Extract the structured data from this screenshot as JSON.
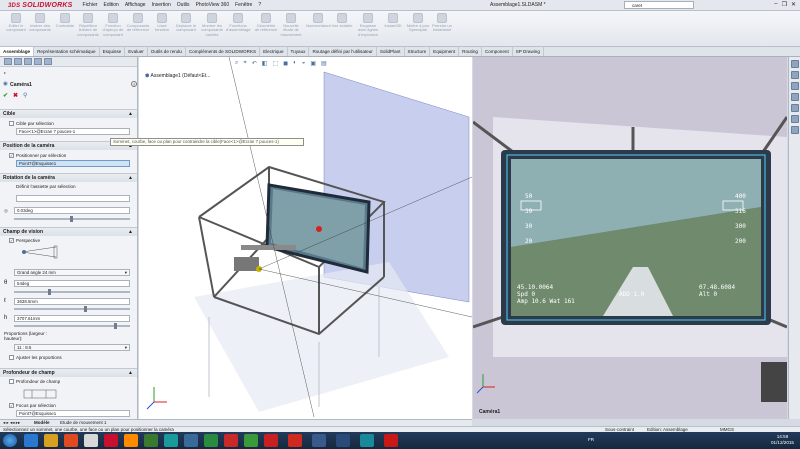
{
  "app": {
    "logo_prefix": "3DS",
    "logo_text": "SOLIDWORKS",
    "document_title": "Assemblage1.SLDASM *",
    "search_value": "caret",
    "menu": [
      "Fichier",
      "Edition",
      "Affichage",
      "Insertion",
      "Outils",
      "PhotoView 360",
      "Fenêtre",
      "?"
    ]
  },
  "ribbon": {
    "buttons": [
      "Editer le composant",
      "Insérer des composants",
      "Contrainte",
      "Répétition linéaire de composants",
      "Fonction d'aperçu de composant",
      "Composants de référence",
      "Lissé fonction",
      "Déplacer le composant",
      "Montrer les composants cachés",
      "Fonctions d'assemblage",
      "Géométrie de référence",
      "Nouvelle étude de mouvement",
      "Nomenclature",
      "Vue éclatée",
      "Esquisse avec lignes d'explosion",
      "Instant3D",
      "Mettre à jour Speedpak",
      "Prendre un instantané"
    ]
  },
  "tabs": [
    "Assemblage",
    "Représentation schématique",
    "Esquisse",
    "Evaluer",
    "Outils de rendu",
    "Compléments de SOLIDWORKS",
    "Electrique",
    "Tuyaux",
    "Routage défini par l'utilisateur",
    "SolidPlant",
    "Structure",
    "Equipment",
    "Routing",
    "Component",
    "SP Drawing"
  ],
  "panel": {
    "title": "Caméra1",
    "help_icon": "?",
    "sections": {
      "target": "Cible",
      "camera_position": "Position de la caméra",
      "camera_rotation": "Rotation de la caméra",
      "field_of_view": "Champ de vision",
      "depth_of_field": "Profondeur de champ"
    },
    "target_checkbox": "Cible par sélection",
    "target_value": "Face<1>@Ecran 7 pouces-1",
    "position_checkbox": "Positionner par sélection",
    "position_value": "Point7@Esquisse1",
    "rotation_label": "Définir l'assiette par sélection",
    "rotation_value": "0.03deg",
    "perspective_label": "Perspective",
    "lens": "Grand angle 24 mm",
    "angle_value": "54deg",
    "distance_value": "3638.5mm",
    "height_value": "3707.61mm",
    "proportions_label": "Proportions (largeur : hauteur):",
    "proportions_value": "11 : 8.5",
    "adjust_label": "Ajuster les proportions",
    "depth_label": "Profondeur de champ",
    "focus_label": "Focus par sélection",
    "focus_value": "Point7@Esquisse1"
  },
  "tooltip": "Sommet, courbe, face ou plan pour contraindre la cible(Face<1>@Ecran 7 pouces-1)",
  "viewport": {
    "tree_label": "Assemblage1 (Défaut<Et...",
    "osd_left": [
      "50",
      "39",
      "30",
      "20"
    ],
    "osd_right": [
      "400",
      "316",
      "300",
      "200"
    ],
    "osd_bottom_1": "45.10.0064",
    "osd_bottom_2": "Spd 0",
    "osd_bottom_3": "Amp 10.6 Wat 161",
    "osd_bottom_4": "07.48.6084",
    "osd_bottom_5": "Alt 0",
    "osd_bottom_6": "ADD 1.0"
  },
  "rightview": {
    "label": "Caméra1"
  },
  "bottom": {
    "tabs": [
      "Modèle",
      "Etude de mouvement 1"
    ],
    "status_left": "Sélectionnez un sommet, une courbe, une face ou un plan pour positionner la caméra",
    "status_mid": "Sous-contraint",
    "status_edit": "Edition: Assemblage",
    "status_units": "MMGS"
  },
  "taskbar": {
    "time": "14:59",
    "date": "01/12/2015",
    "lang": "FR"
  },
  "colors": {
    "accent": "#c8102e",
    "plane": "#9aa8e0",
    "screen_border": "#2c3a4a"
  }
}
